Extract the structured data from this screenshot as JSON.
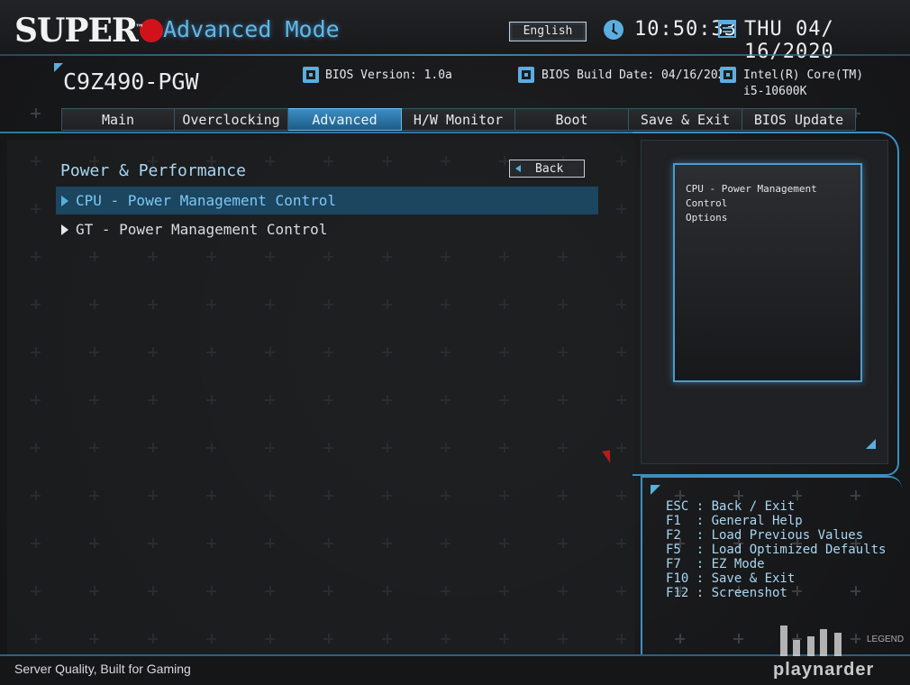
{
  "header": {
    "logo_text": "SUPER",
    "logo_tm": "™",
    "mode_title": "Advanced Mode",
    "language": "English",
    "time": "10:50:33",
    "date": "THU 04/ 16/2020"
  },
  "system": {
    "model": "C9Z490-PGW",
    "bios_version_label": "BIOS Version: 1.0a",
    "bios_build_date_label": "BIOS Build Date: 04/16/2020",
    "cpu_line1": "Intel(R) Core(TM)",
    "cpu_line2": "i5-10600K"
  },
  "tabs": [
    {
      "label": "Main",
      "active": false
    },
    {
      "label": "Overclocking",
      "active": false
    },
    {
      "label": "Advanced",
      "active": true
    },
    {
      "label": "H/W Monitor",
      "active": false
    },
    {
      "label": "Boot",
      "active": false
    },
    {
      "label": "Save & Exit",
      "active": false
    },
    {
      "label": "BIOS Update",
      "active": false
    }
  ],
  "main": {
    "section_title": "Power & Performance",
    "back_label": "Back",
    "items": [
      {
        "label": "CPU - Power Management Control",
        "selected": true
      },
      {
        "label": "GT - Power Management Control",
        "selected": false
      }
    ]
  },
  "help": {
    "line1": "CPU - Power Management Control",
    "line2": "Options"
  },
  "keys": [
    "ESC : Back / Exit",
    "F1  : General Help",
    "F2  : Load Previous Values",
    "F5  : Load Optimized Defaults",
    "F7  : EZ Mode",
    "F10 : Save & Exit",
    "F12 : Screenshot"
  ],
  "footer": {
    "tagline": "Server Quality, Built for Gaming",
    "watermark": "playnarder",
    "watermark_small": "LEGEND"
  },
  "colors": {
    "accent": "#5aaee0",
    "active_tab": "#3b8ec4",
    "selected_row": "#1c4560",
    "logo_dot": "#d2121a"
  },
  "icons": {
    "clock": "clock-icon",
    "calendar": "calendar-icon",
    "bios_chip": "chip-icon",
    "build_chip": "chip-icon",
    "cpu_chip": "cpu-icon"
  }
}
